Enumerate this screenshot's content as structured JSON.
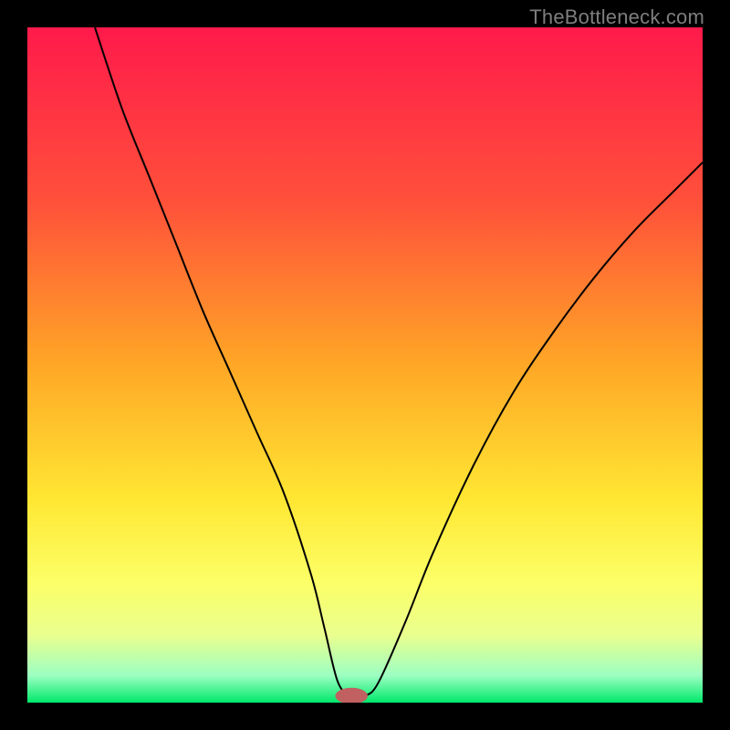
{
  "watermark": "TheBottleneck.com",
  "chart_data": {
    "type": "line",
    "title": "",
    "xlabel": "",
    "ylabel": "",
    "xlim": [
      0,
      100
    ],
    "ylim": [
      0,
      100
    ],
    "grid": false,
    "background_gradient_stops": [
      {
        "offset": 0,
        "color": "#ff1a4b"
      },
      {
        "offset": 26,
        "color": "#ff513a"
      },
      {
        "offset": 50,
        "color": "#ffa726"
      },
      {
        "offset": 70,
        "color": "#ffe733"
      },
      {
        "offset": 82,
        "color": "#fcff66"
      },
      {
        "offset": 90,
        "color": "#eaff8e"
      },
      {
        "offset": 96,
        "color": "#9cffc2"
      },
      {
        "offset": 100,
        "color": "#00e86a"
      }
    ],
    "series": [
      {
        "name": "bottleneck-curve",
        "type": "line",
        "stroke": "#000000",
        "stroke_width": 2,
        "x": [
          10,
          14,
          18,
          22,
          26,
          30,
          34,
          38,
          42,
          44,
          46,
          48,
          50,
          52,
          56,
          60,
          66,
          72,
          78,
          84,
          90,
          96,
          100
        ],
        "y": [
          100,
          88,
          78,
          68,
          58,
          49,
          40,
          31,
          19,
          11,
          3,
          1,
          1,
          3,
          12,
          22,
          35,
          46,
          55,
          63,
          70,
          76,
          80
        ]
      }
    ],
    "marker": {
      "name": "min-point-marker",
      "x": 48,
      "y": 1,
      "rx": 2.4,
      "ry": 1.2,
      "fill": "#c16060"
    }
  }
}
